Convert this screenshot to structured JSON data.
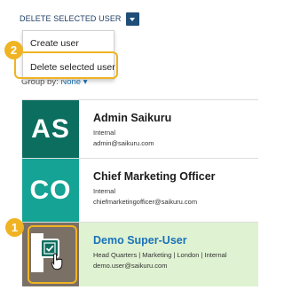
{
  "toolbar": {
    "action_label": "DELETE SELECTED USER"
  },
  "menu": {
    "items": [
      {
        "label": "Create user"
      },
      {
        "label": "Delete selected user"
      }
    ]
  },
  "groupby": {
    "label": "Group by:",
    "value": "None"
  },
  "steps": {
    "one": "1",
    "two": "2"
  },
  "users": [
    {
      "initials": "AS",
      "name": "Admin Saikuru",
      "line1": "Internal",
      "line2": "admin@saikuru.com",
      "color": "#0b6e5e"
    },
    {
      "initials": "CO",
      "name": "Chief Marketing Officer",
      "line1": "Internal",
      "line2": "chiefmarketingofficer@saikuru.com",
      "color": "#14a394"
    },
    {
      "initials": "",
      "name": "Demo Super-User",
      "line1": "Head Quarters | Marketing | London | Internal",
      "line2": "demo.user@saikuru.com",
      "color": "#7a7066",
      "selected": true
    }
  ],
  "colors": {
    "highlight": "#f0b323",
    "selected_row_bg": "#dff2d2",
    "accent": "#1f4e78",
    "link": "#1a73b8"
  }
}
